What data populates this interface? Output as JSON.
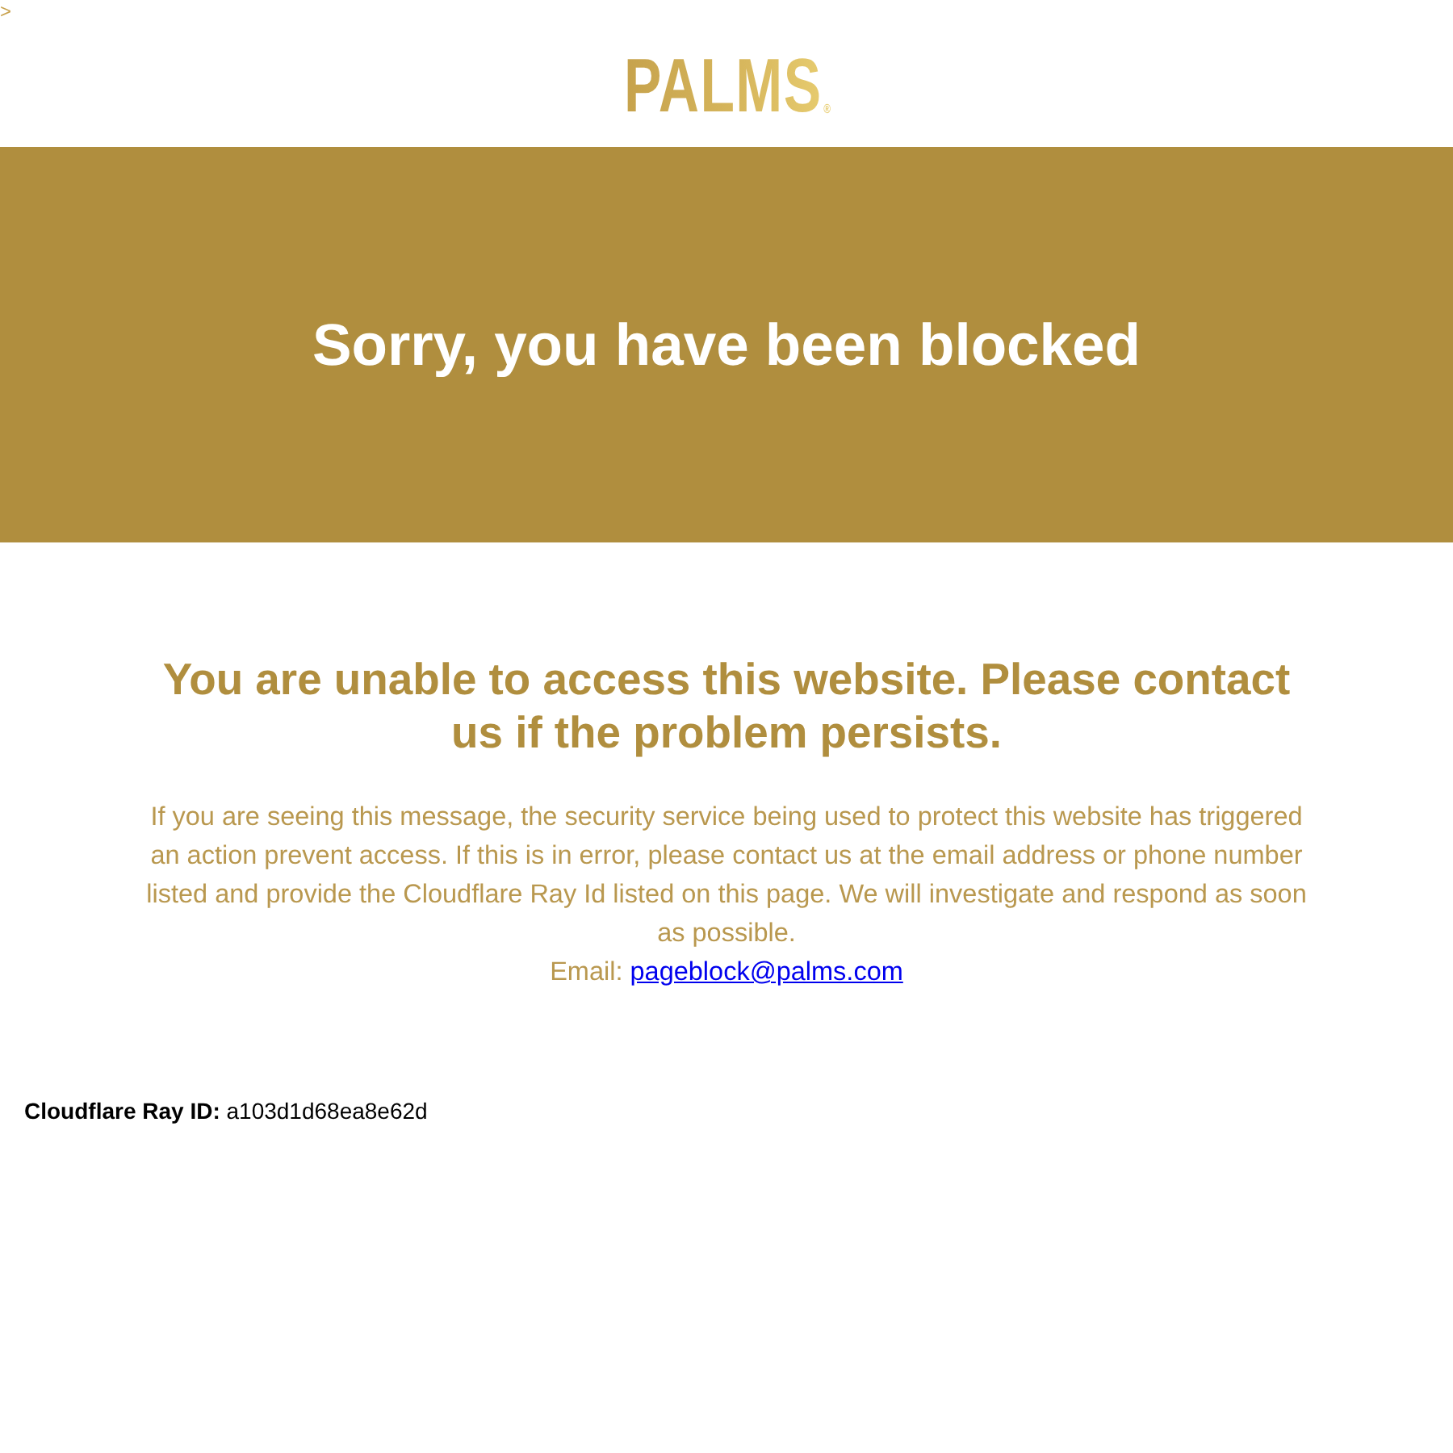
{
  "stray_text": ">",
  "logo": {
    "text": "PALMS",
    "mark": "®"
  },
  "banner": {
    "title": "Sorry, you have been blocked"
  },
  "message": {
    "heading": "You are unable to access this website. Please contact us if the problem persists.",
    "body": "If you are seeing this message, the security service being used to protect this website has triggered an action prevent access. If this is in error, please contact us at the email address or phone number listed and provide the Cloudflare Ray Id listed on this page. We will investigate and respond as soon as possible.",
    "email_label": "Email:",
    "email_link": "pageblock@palms.com"
  },
  "ray_id": {
    "label": "Cloudflare Ray ID:",
    "value": "a103d1d68ea8e62d"
  }
}
